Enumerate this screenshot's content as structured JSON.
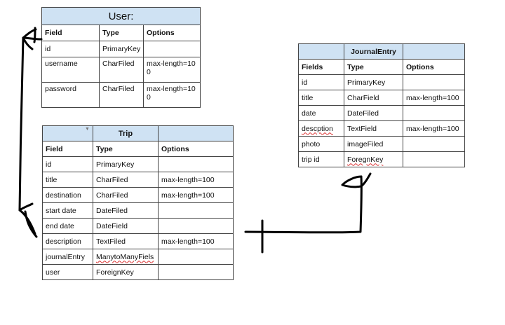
{
  "user_table": {
    "title": "User:",
    "headers": [
      "Field",
      "Type",
      "Options"
    ],
    "rows": [
      [
        "id",
        "PrimaryKey",
        ""
      ],
      [
        "username",
        "CharFiled",
        "max-length=10\n0"
      ],
      [
        "password",
        "CharFiled",
        "max-length=10\n0"
      ]
    ]
  },
  "trip_table": {
    "title": "Trip",
    "headers": [
      "Field",
      "Type",
      "Options"
    ],
    "rows": [
      [
        "id",
        "PrimaryKey",
        ""
      ],
      [
        "title",
        "CharFiled",
        "max-length=100"
      ],
      [
        "destination",
        "CharFiled",
        "max-length=100"
      ],
      [
        "start date",
        "DateFiled",
        ""
      ],
      [
        "end date",
        "DateField",
        ""
      ],
      [
        "description",
        "TextFiled",
        "max-length=100"
      ],
      [
        "journalEntry",
        "ManytoManyFiels",
        ""
      ],
      [
        "user",
        "ForeignKey",
        ""
      ]
    ]
  },
  "journal_table": {
    "title": "JournalEntry",
    "headers": [
      "Fields",
      "Type",
      "Options"
    ],
    "rows": [
      [
        "id",
        "PrimaryKey",
        ""
      ],
      [
        "title",
        "CharField",
        "max-length=100"
      ],
      [
        "date",
        "DateFiled",
        ""
      ],
      [
        "descption",
        "TextField",
        "max-length=100"
      ],
      [
        "photo",
        "imageFiled",
        ""
      ],
      [
        "trip id",
        "ForegnKey",
        ""
      ]
    ]
  },
  "colors": {
    "header_bg": "#cfe2f3",
    "ink": "#000000",
    "border": "#444444",
    "spellcheck": "#d33333"
  }
}
